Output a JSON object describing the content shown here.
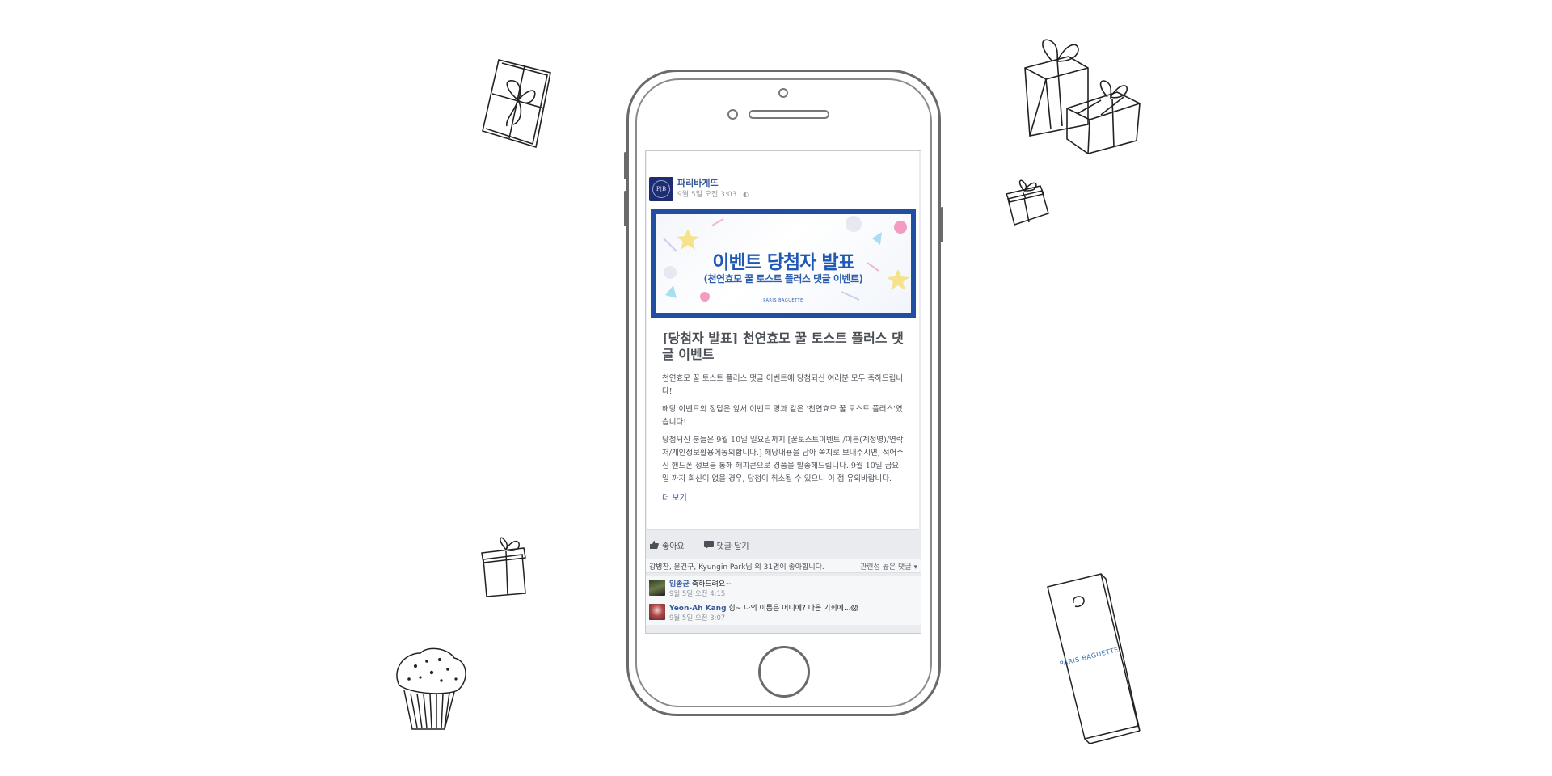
{
  "post": {
    "page_name": "파리바게뜨",
    "avatar_text": "P|B",
    "timestamp": "9월 5일 오전 3:03 ·",
    "globe_icon": "globe-icon",
    "banner": {
      "title": "이벤트 당첨자 발표",
      "subtitle": "(천연효모 꿀 토스트 플러스 댓글 이벤트)",
      "brand": "PARIS BAGUETTE"
    },
    "article_title": "[당첨자 발표] 천연효모 꿀 토스트 플러스 댓글 이벤트",
    "paragraphs": [
      "천연효모 꿀 토스트 플러스 댓글 이벤트에 당첨되신 여러분 모두 축하드립니다!",
      "해당 이벤트의 정답은 앞서 이벤트 명과 같은 '천연효모 꿀 토스트 플러스'였습니다!",
      "당첨되신 분들은 9월 10일 일요일까지 [꿀토스트이벤트 /이름(계정명)/연락처/개인정보활용에동의합니다.] 해당내용을 담아 쪽지로 보내주시면, 적어주신 핸드폰 정보를 통해 해피콘으로 경품을 발송해드립니다. 9월 10일 금요일 까지 회신이 없을 경우, 당첨이 취소될 수 있으니 이 점 유의바랍니다."
    ],
    "see_more": "더 보기"
  },
  "actions": {
    "like_label": "좋아요",
    "comment_label": "댓글 달기"
  },
  "likes_bar": {
    "text": "강병찬, 윤건구, Kyungin Park님 외 31명이 좋아합니다.",
    "sort_label": "관련성 높은 댓글 ▾"
  },
  "comments": [
    {
      "name": "임종균",
      "text": "축하드려요~",
      "time": "9월 5일 오전 4:15"
    },
    {
      "name": "Yeon-Ah Kang",
      "text": "힝~ 나의 이름은 어디에? 다음 기회에...😱",
      "time": "9월 5일 오전 3:07"
    }
  ],
  "bag_brand": "PARIS BAGUETTE",
  "colors": {
    "facebook_link": "#365899",
    "banner_blue": "#1f4ea3",
    "outline": "#333333"
  }
}
